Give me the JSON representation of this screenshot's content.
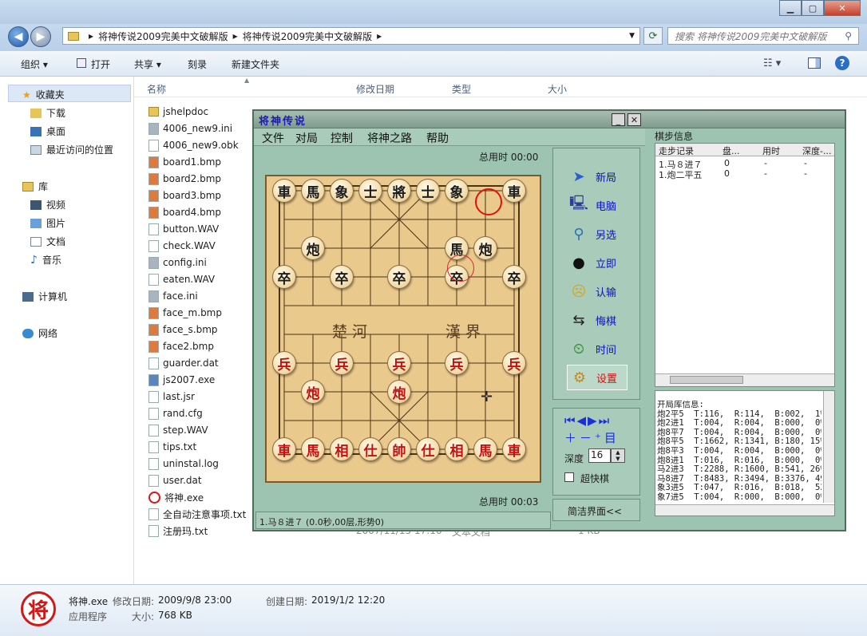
{
  "explorer": {
    "breadcrumb": [
      "将神传说2009完美中文破解版",
      "将神传说2009完美中文破解版"
    ],
    "search_placeholder": "搜索 将神传说2009完美中文破解版",
    "commands": [
      "组织 ▾",
      "打开",
      "共享 ▾",
      "刻录",
      "新建文件夹"
    ],
    "sidebar": {
      "favorites": "收藏夹",
      "fav_items": [
        "下载",
        "桌面",
        "最近访问的位置"
      ],
      "library": "库",
      "lib_items": [
        "视频",
        "图片",
        "文档",
        "音乐"
      ],
      "computer": "计算机",
      "network": "网络"
    },
    "columns": [
      "名称",
      "修改日期",
      "类型",
      "大小"
    ],
    "files": [
      "jshelpdoc",
      "4006_new9.ini",
      "4006_new9.obk",
      "board1.bmp",
      "board2.bmp",
      "board3.bmp",
      "board4.bmp",
      "button.WAV",
      "check.WAV",
      "config.ini",
      "eaten.WAV",
      "face.ini",
      "face_m.bmp",
      "face_s.bmp",
      "face2.bmp",
      "guarder.dat",
      "js2007.exe",
      "last.jsr",
      "rand.cfg",
      "step.WAV",
      "tips.txt",
      "uninstal.log",
      "user.dat",
      "将神.exe",
      "全自动注意事项.txt",
      "注册玛.txt"
    ],
    "partial_row": {
      "date": "2007/11/15 17:16",
      "type": "文本文档",
      "size": "1 KB"
    },
    "details": {
      "name": "将神.exe",
      "modified_label": "修改日期:",
      "modified": "2009/9/8 23:00",
      "created_label": "创建日期:",
      "created": "2019/1/2 12:20",
      "type": "应用程序",
      "size_label": "大小:",
      "size": "768 KB"
    }
  },
  "game": {
    "title": "将神传说",
    "menu": [
      "文件",
      "对局",
      "控制",
      "将神之路",
      "帮助"
    ],
    "time_top": "总用时 00:00",
    "time_bottom": "总用时 00:03",
    "river_left": "楚河",
    "river_right": "漢界",
    "status": "1.马８进７ (0.0秒,00层,形势0)",
    "tools": [
      "新局",
      "电脑",
      "另选",
      "立即",
      "认输",
      "悔棋",
      "时间",
      "设置"
    ],
    "depth_label": "深度",
    "depth_value": "16",
    "fast_label": "超快棋",
    "simple_label": "简洁界面<<",
    "moves_title": "棋步信息",
    "moves_cols": [
      "走步记录",
      "盘...",
      "用时",
      "深度-..."
    ],
    "moves_rows": [
      [
        "1.马８进７",
        "0",
        "-",
        "-"
      ],
      [
        "1.炮二平五",
        "0",
        "-",
        "-"
      ]
    ],
    "opening_text": "开局库信息:\n炮2平5  T:116,  R:114,  B:002,  1%\n炮2进1  T:004,  R:004,  B:000,  0%\n炮8平7  T:004,  R:004,  B:000,  0%\n炮8平5  T:1662, R:1341, B:180, 15%\n炮8平3  T:004,  R:004,  B:000,  0%\n炮8进1  T:016,  R:016,  B:000,  0%\n马2进3  T:2288, R:1600, B:541, 26%\n马8进7  T:8483, R:3494, B:3376, 49\n象3进5  T:047,  R:016,  B:018,  52%\n象7进5  T:004,  R:000,  B:000,  0%",
    "pieces": [
      {
        "t": "車",
        "c": "black",
        "col": 0,
        "row": 0
      },
      {
        "t": "馬",
        "c": "black",
        "col": 1,
        "row": 0
      },
      {
        "t": "象",
        "c": "black",
        "col": 2,
        "row": 0
      },
      {
        "t": "士",
        "c": "black",
        "col": 3,
        "row": 0
      },
      {
        "t": "將",
        "c": "black",
        "col": 4,
        "row": 0
      },
      {
        "t": "士",
        "c": "black",
        "col": 5,
        "row": 0
      },
      {
        "t": "象",
        "c": "black",
        "col": 6,
        "row": 0
      },
      {
        "t": "車",
        "c": "black",
        "col": 8,
        "row": 0
      },
      {
        "t": "炮",
        "c": "black",
        "col": 1,
        "row": 2
      },
      {
        "t": "馬",
        "c": "black",
        "col": 6,
        "row": 2
      },
      {
        "t": "炮",
        "c": "black",
        "col": 7,
        "row": 2
      },
      {
        "t": "卒",
        "c": "black",
        "col": 0,
        "row": 3
      },
      {
        "t": "卒",
        "c": "black",
        "col": 2,
        "row": 3
      },
      {
        "t": "卒",
        "c": "black",
        "col": 4,
        "row": 3
      },
      {
        "t": "卒",
        "c": "black",
        "col": 6,
        "row": 3
      },
      {
        "t": "卒",
        "c": "black",
        "col": 8,
        "row": 3
      },
      {
        "t": "兵",
        "c": "red",
        "col": 0,
        "row": 6
      },
      {
        "t": "兵",
        "c": "red",
        "col": 2,
        "row": 6
      },
      {
        "t": "兵",
        "c": "red",
        "col": 4,
        "row": 6
      },
      {
        "t": "兵",
        "c": "red",
        "col": 6,
        "row": 6
      },
      {
        "t": "兵",
        "c": "red",
        "col": 8,
        "row": 6
      },
      {
        "t": "炮",
        "c": "red",
        "col": 1,
        "row": 7
      },
      {
        "t": "炮",
        "c": "red",
        "col": 4,
        "row": 7
      },
      {
        "t": "車",
        "c": "red",
        "col": 0,
        "row": 9
      },
      {
        "t": "馬",
        "c": "red",
        "col": 1,
        "row": 9
      },
      {
        "t": "相",
        "c": "red",
        "col": 2,
        "row": 9
      },
      {
        "t": "仕",
        "c": "red",
        "col": 3,
        "row": 9
      },
      {
        "t": "帥",
        "c": "red",
        "col": 4,
        "row": 9
      },
      {
        "t": "仕",
        "c": "red",
        "col": 5,
        "row": 9
      },
      {
        "t": "相",
        "c": "red",
        "col": 6,
        "row": 9
      },
      {
        "t": "馬",
        "c": "red",
        "col": 7,
        "row": 9
      },
      {
        "t": "車",
        "c": "red",
        "col": 8,
        "row": 9
      }
    ]
  }
}
